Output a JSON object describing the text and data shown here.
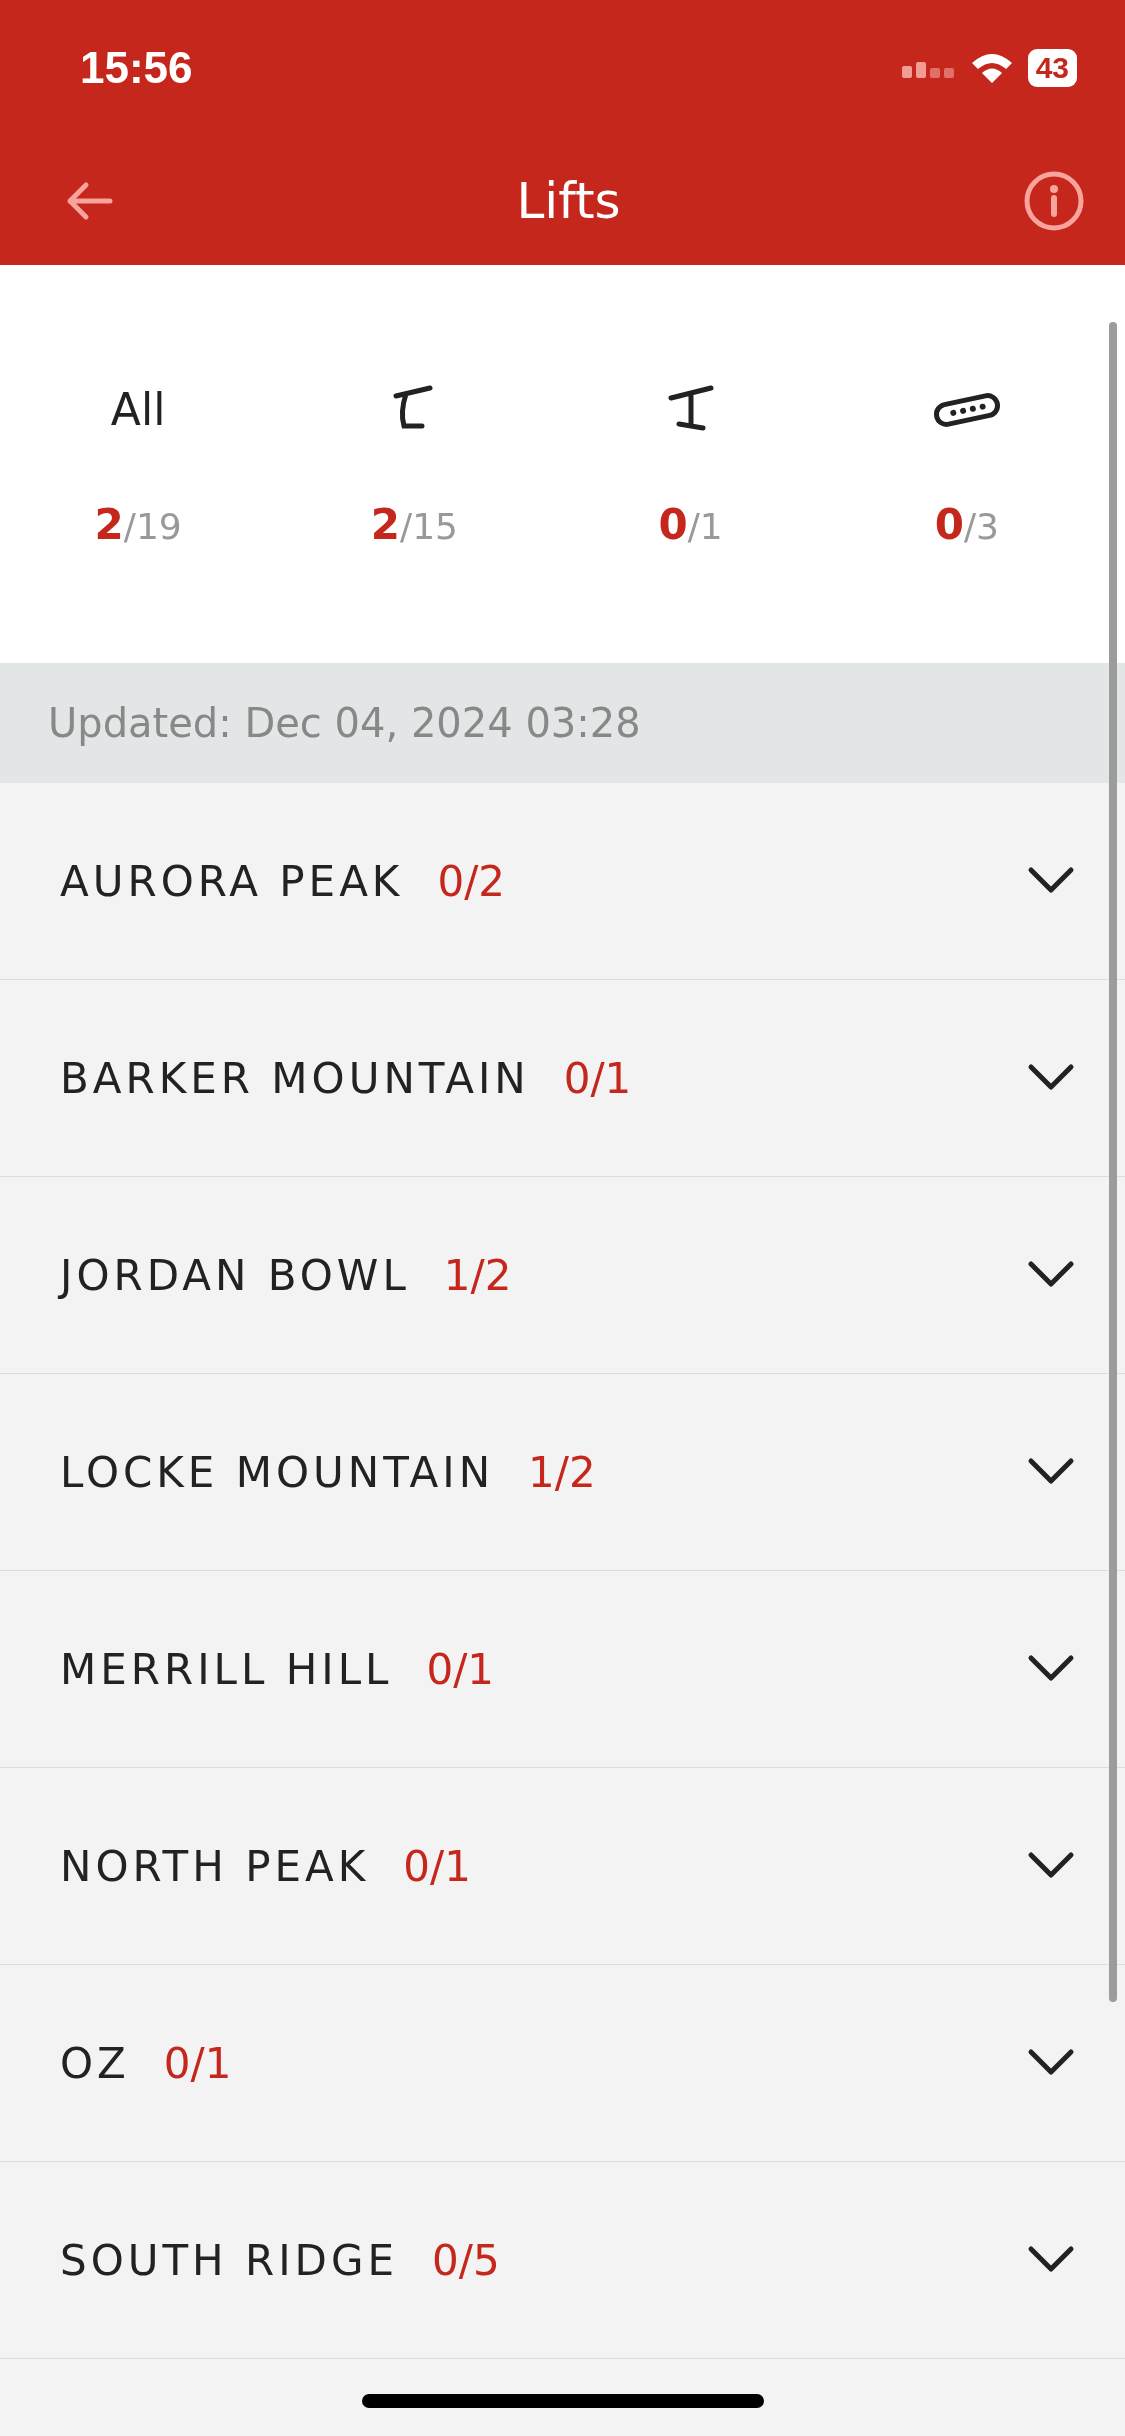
{
  "status_bar": {
    "time": "15:56",
    "battery": "43"
  },
  "nav": {
    "title": "Lifts"
  },
  "filters": [
    {
      "kind": "text",
      "label": "All",
      "open": "2",
      "total": "/19"
    },
    {
      "kind": "chairlift",
      "open": "2",
      "total": "/15"
    },
    {
      "kind": "tbar",
      "open": "0",
      "total": "/1"
    },
    {
      "kind": "carpet",
      "open": "0",
      "total": "/3"
    }
  ],
  "updated": "Updated: Dec 04, 2024 03:28",
  "areas": [
    {
      "name": "AURORA PEAK",
      "count": "0/2",
      "expanded": false
    },
    {
      "name": "BARKER MOUNTAIN",
      "count": "0/1",
      "expanded": false
    },
    {
      "name": "JORDAN BOWL",
      "count": "1/2",
      "expanded": false
    },
    {
      "name": "LOCKE MOUNTAIN",
      "count": "1/2",
      "expanded": false
    },
    {
      "name": "MERRILL HILL",
      "count": "0/1",
      "expanded": false
    },
    {
      "name": "NORTH PEAK",
      "count": "0/1",
      "expanded": false
    },
    {
      "name": "OZ",
      "count": "0/1",
      "expanded": false
    },
    {
      "name": "SOUTH RIDGE",
      "count": "0/5",
      "expanded": false
    }
  ]
}
